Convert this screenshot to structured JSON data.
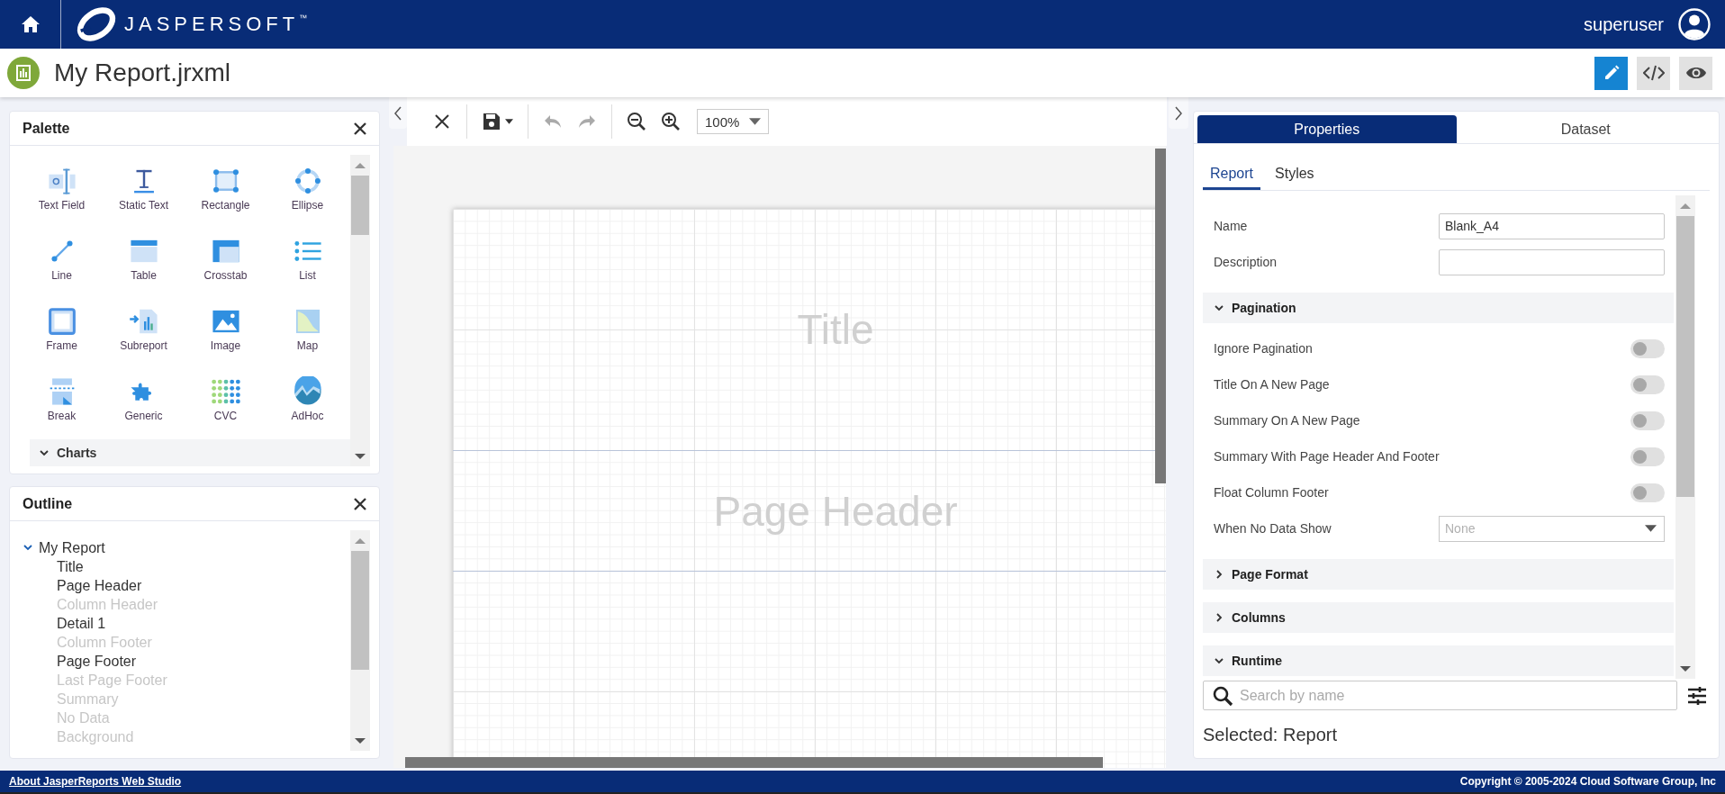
{
  "header": {
    "logo_text": "JASPERSOFT",
    "logo_mark": "™",
    "user": "superuser"
  },
  "document": {
    "title": "My Report.jrxml"
  },
  "view_modes": [
    {
      "kind": "design",
      "selected": true
    },
    {
      "kind": "source",
      "selected": false
    },
    {
      "kind": "preview",
      "selected": false
    }
  ],
  "toolbar": {
    "groups": [
      [
        {
          "kind": "close",
          "disabled": false
        }
      ],
      [
        {
          "kind": "save",
          "disabled": false
        }
      ],
      [
        {
          "kind": "undo",
          "disabled": true
        },
        {
          "kind": "redo",
          "disabled": true
        }
      ],
      [
        {
          "kind": "zoom_out",
          "disabled": false
        },
        {
          "kind": "zoom_in",
          "disabled": false
        }
      ]
    ],
    "zoom": "100%"
  },
  "palette": {
    "title": "Palette",
    "items": [
      {
        "kind": "text_field",
        "label": "Text Field"
      },
      {
        "kind": "static_text",
        "label": "Static Text"
      },
      {
        "kind": "rectangle",
        "label": "Rectangle"
      },
      {
        "kind": "ellipse",
        "label": "Ellipse"
      },
      {
        "kind": "line",
        "label": "Line"
      },
      {
        "kind": "table",
        "label": "Table"
      },
      {
        "kind": "crosstab",
        "label": "Crosstab"
      },
      {
        "kind": "list",
        "label": "List"
      },
      {
        "kind": "frame",
        "label": "Frame"
      },
      {
        "kind": "subreport",
        "label": "Subreport"
      },
      {
        "kind": "image",
        "label": "Image"
      },
      {
        "kind": "map",
        "label": "Map"
      },
      {
        "kind": "break",
        "label": "Break"
      },
      {
        "kind": "generic",
        "label": "Generic"
      },
      {
        "kind": "cvc",
        "label": "CVC"
      },
      {
        "kind": "adhoc",
        "label": "AdHoc"
      }
    ],
    "section": {
      "label": "Charts",
      "expanded": true
    }
  },
  "outline": {
    "title": "Outline",
    "tree": [
      {
        "label": "My Report",
        "expanded": true,
        "children": [
          {
            "label": "Title",
            "disabled": false
          },
          {
            "label": "Page Header",
            "disabled": false
          },
          {
            "label": "Column Header",
            "disabled": true
          },
          {
            "label": "Detail 1",
            "disabled": false
          },
          {
            "label": "Column Footer",
            "disabled": true
          },
          {
            "label": "Page Footer",
            "disabled": false
          },
          {
            "label": "Last Page Footer",
            "disabled": true
          },
          {
            "label": "Summary",
            "disabled": true
          },
          {
            "label": "No Data",
            "disabled": true
          },
          {
            "label": "Background",
            "disabled": true
          }
        ]
      }
    ]
  },
  "canvas": {
    "bands": [
      {
        "label": "Title"
      },
      {
        "label": "Page Header"
      }
    ]
  },
  "properties": {
    "tabs": [
      {
        "label": "Properties",
        "selected": true
      },
      {
        "label": "Dataset",
        "selected": false
      }
    ],
    "subtabs": [
      {
        "label": "Report",
        "selected": true
      },
      {
        "label": "Styles",
        "selected": false
      }
    ],
    "fields": [
      {
        "kind": "text",
        "label": "Name",
        "value": "Blank_A4"
      },
      {
        "kind": "text",
        "label": "Description"
      }
    ],
    "sections": [
      {
        "label": "Pagination",
        "expanded": true,
        "rows": [
          {
            "kind": "toggle",
            "label": "Ignore Pagination",
            "on": false
          },
          {
            "kind": "toggle",
            "label": "Title On A New Page",
            "on": false
          },
          {
            "kind": "toggle",
            "label": "Summary On A New Page",
            "on": false
          },
          {
            "kind": "toggle",
            "label": "Summary With Page Header And Footer",
            "on": false
          },
          {
            "kind": "toggle",
            "label": "Float Column Footer",
            "on": false
          },
          {
            "kind": "select",
            "label": "When No Data Show",
            "value": "None"
          }
        ]
      },
      {
        "label": "Page Format",
        "expanded": false
      },
      {
        "label": "Columns",
        "expanded": false
      },
      {
        "label": "Runtime",
        "expanded": true
      }
    ],
    "search": {
      "placeholder": "Search by name"
    },
    "selected_text": "Selected: Report"
  },
  "footer": {
    "link": "About JasperReports Web Studio",
    "copyright": "Copyright © 2005-2024 Cloud Software Group, Inc"
  }
}
